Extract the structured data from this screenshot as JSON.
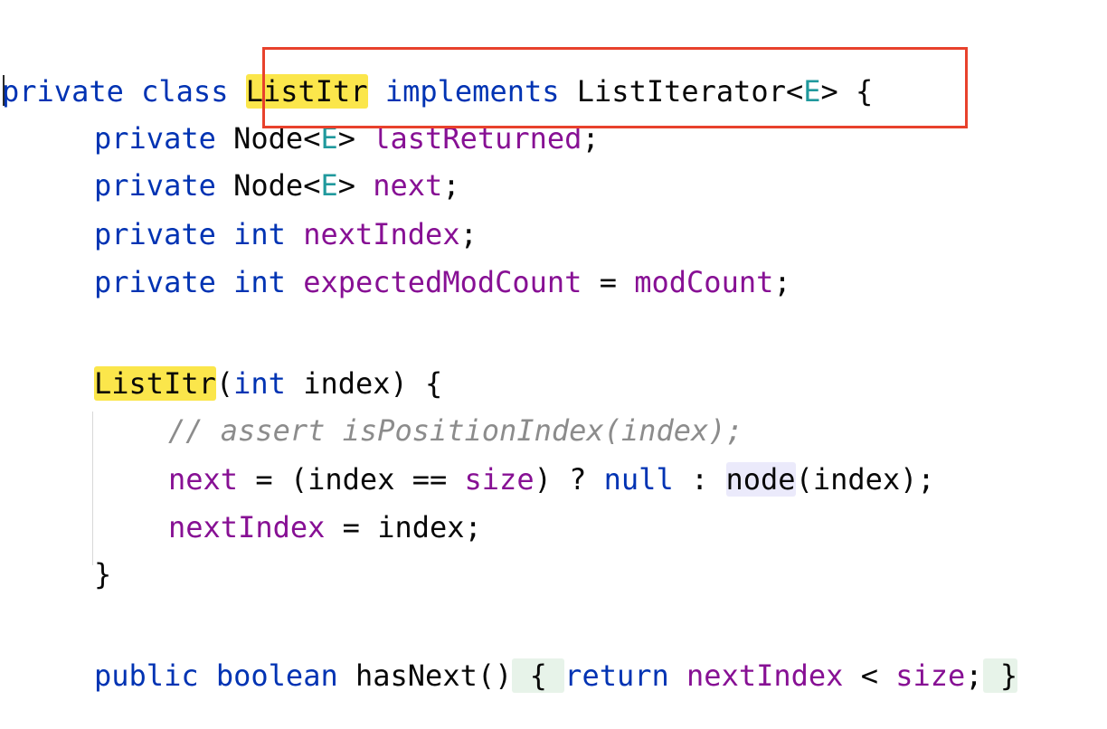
{
  "colors": {
    "keyword": "#0033b3",
    "generic": "#20999d",
    "field": "#871094",
    "comment": "#8c8c8c",
    "highlight": "#fbe64b",
    "usage_highlight": "#ebeafb",
    "folded_region": "#e7f3e9",
    "annotation_box": "#e8412c"
  },
  "code": {
    "line1": {
      "kw1": "private class",
      "name": "ListItr",
      "kw2": "implements",
      "type": "ListIterator<",
      "gen": "E",
      "rest": "> {"
    },
    "line2": {
      "kw": "private",
      "type": "Node<",
      "gen": "E",
      "type2": ">",
      "field": "lastReturned",
      "punct": ";"
    },
    "line3": {
      "kw": "private",
      "type": "Node<",
      "gen": "E",
      "type2": ">",
      "field": "next",
      "punct": ";"
    },
    "line4": {
      "kw": "private int",
      "field": "nextIndex",
      "punct": ";"
    },
    "line5": {
      "kw": "private int",
      "field": "expectedModCount",
      "op": " = ",
      "field2": "modCount",
      "punct": ";"
    },
    "line6": {
      "name": "ListItr",
      "open": "(",
      "kw": "int",
      "rest": " index) {"
    },
    "line7": {
      "comment": "// assert isPositionIndex(index);"
    },
    "line8": {
      "field": "next",
      "op": " = (index == ",
      "field2": "size",
      "op2": ") ? ",
      "kw": "null",
      "op3": " : ",
      "method": "node",
      "rest": "(index);"
    },
    "line9": {
      "field": "nextIndex",
      "rest": " = index;"
    },
    "line10": {
      "brace": "}"
    },
    "line11": {
      "kw": "public boolean",
      "method": "hasNext",
      "paren": "()",
      "fold_open": "{",
      "kw2": "return",
      "field": "nextIndex",
      "op": " < ",
      "field2": "size",
      "semi": ";",
      "fold_close": "}"
    }
  }
}
